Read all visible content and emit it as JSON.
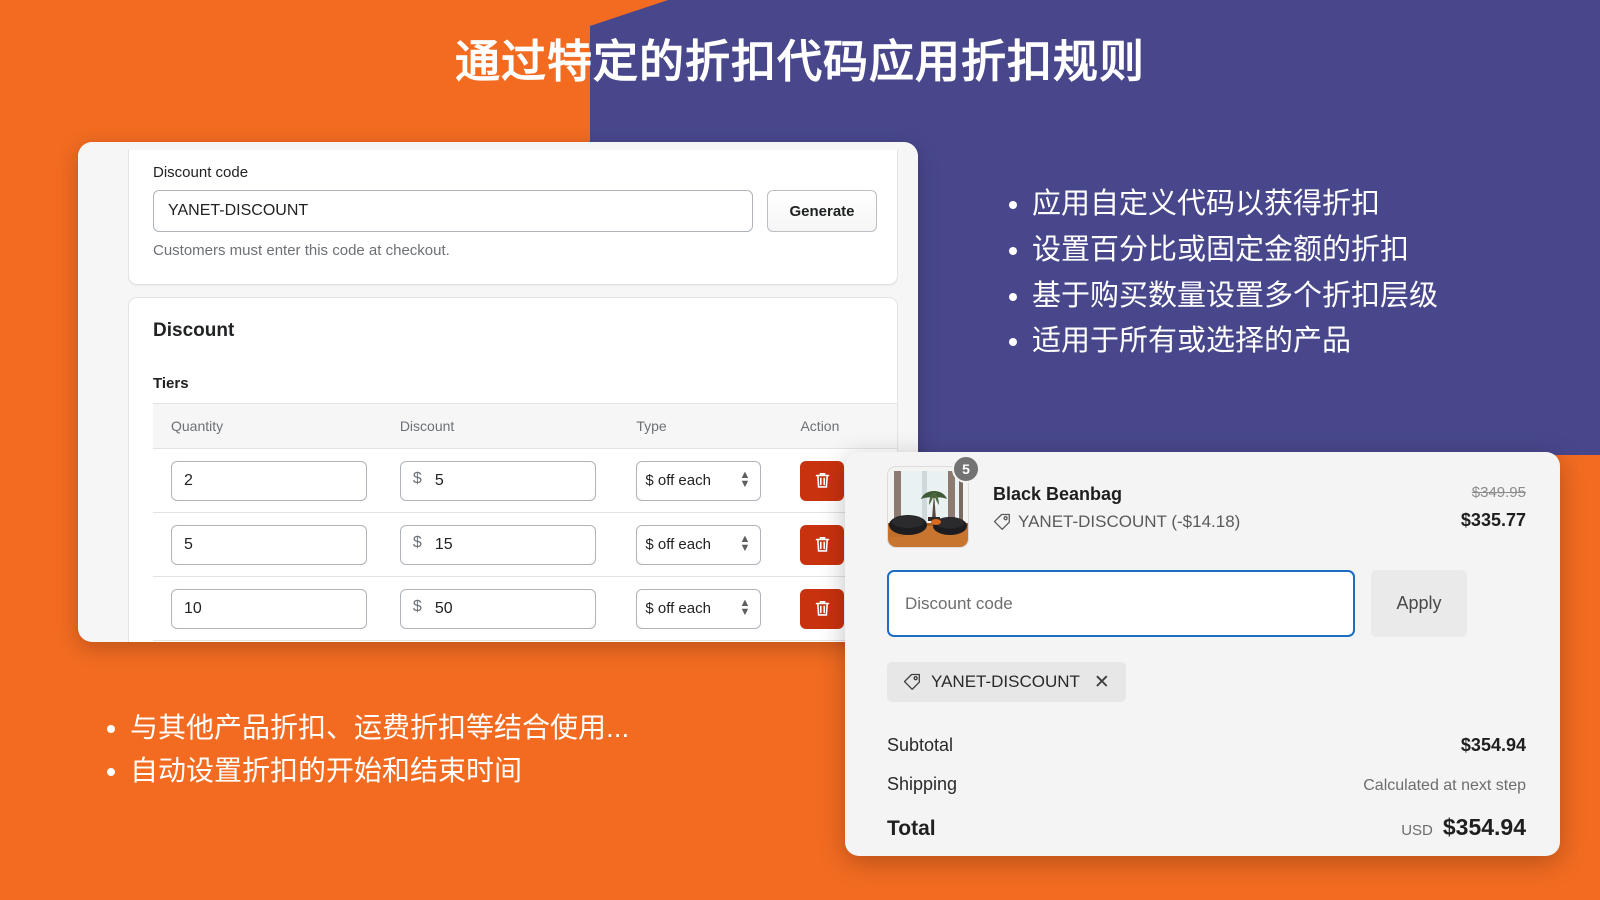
{
  "theme": {
    "orange": "#F26B21",
    "purple": "#48478C",
    "delete_red": "#C9320E",
    "focus_blue": "#1B6EC2"
  },
  "title": "通过特定的折扣代码应用折扣规则",
  "admin": {
    "discount_code": {
      "label": "Discount code",
      "value": "YANET-DISCOUNT",
      "generate_label": "Generate",
      "help_text": "Customers must enter this code at checkout."
    },
    "discount_section": {
      "heading": "Discount",
      "tiers_label": "Tiers",
      "columns": [
        "Quantity",
        "Discount",
        "Type",
        "Action"
      ],
      "rows": [
        {
          "quantity": "2",
          "currency": "$",
          "discount": "5",
          "type": "$ off each"
        },
        {
          "quantity": "5",
          "currency": "$",
          "discount": "15",
          "type": "$ off each"
        },
        {
          "quantity": "10",
          "currency": "$",
          "discount": "50",
          "type": "$ off each"
        }
      ],
      "delete_icon": "trash-icon"
    }
  },
  "purple_bullets": [
    "应用自定义代码以获得折扣",
    "设置百分比或固定金额的折扣",
    "基于购买数量设置多个折扣层级",
    "适用于所有或选择的产品"
  ],
  "orange_bullets": [
    "与其他产品折扣、运费折扣等结合使用...",
    "自动设置折扣的开始和结束时间"
  ],
  "cart": {
    "product": {
      "name": "Black Beanbag",
      "quantity_badge": "5",
      "discount_line": "YANET-DISCOUNT (-$14.18)",
      "price_original": "$349.95",
      "price_discounted": "$335.77",
      "thumbnail_alt": "room-with-black-beanbags"
    },
    "discount_input": {
      "placeholder": "Discount code",
      "value": "",
      "apply_label": "Apply"
    },
    "applied_chip": {
      "label": "YANET-DISCOUNT",
      "remove_icon": "close-icon"
    },
    "totals": {
      "subtotal_label": "Subtotal",
      "subtotal_value": "$354.94",
      "shipping_label": "Shipping",
      "shipping_value": "Calculated at next step",
      "total_label": "Total",
      "total_currency": "USD",
      "total_value": "$354.94"
    }
  }
}
